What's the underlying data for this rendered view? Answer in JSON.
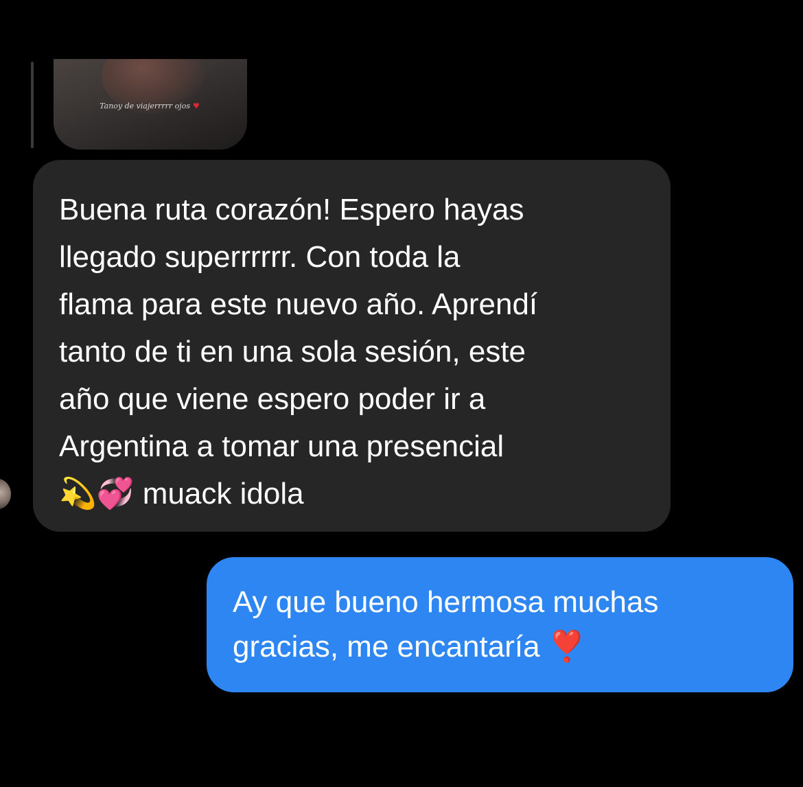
{
  "chat": {
    "story_reply": {
      "caption": "Tanoy de viajerrrrr ojos",
      "caption_icon": "red-heart-icon"
    },
    "messages": [
      {
        "direction": "incoming",
        "text": "Buena ruta corazón! Espero hayas\nllegado superrrrrr. Con toda la\nflama para este nuevo año. Aprendí\ntanto de ti en una sola sesión, este\naño que viene espero poder ir a\nArgentina a tomar una presencial\n💫💞 muack idola",
        "bubble_color": "#262626"
      },
      {
        "direction": "outgoing",
        "text": "Ay que bueno hermosa muchas\ngracias, me encantaría ❣️",
        "bubble_color": "#2e86f2"
      }
    ]
  },
  "colors": {
    "background": "#000000",
    "incoming_bubble": "#262626",
    "outgoing_bubble": "#2e86f2",
    "text": "#ffffff"
  }
}
